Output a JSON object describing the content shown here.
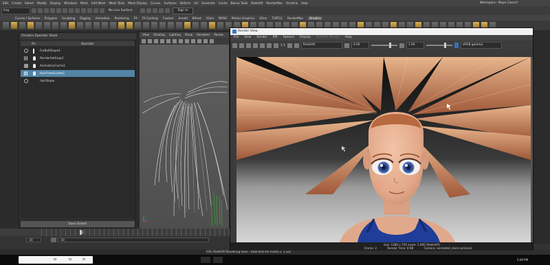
{
  "menubar": {
    "items": [
      "Edit",
      "Create",
      "Select",
      "Modify",
      "Display",
      "Windows",
      "Mesh",
      "Edit Mesh",
      "Mesh Tools",
      "Mesh Display",
      "Curves",
      "Surfaces",
      "Deform",
      "UV",
      "Generate",
      "Cache",
      "Bonus Tools",
      "Redshift",
      "RenderMan",
      "Ornatrix",
      "Help"
    ],
    "workspace": "Workspace : Maya Classic*"
  },
  "statusline": {
    "mode": "ling",
    "live_surface": "No Live Surface",
    "sign_in": "Sign In"
  },
  "shelf_tabs": [
    "Curves / Surfaces",
    "Polygons",
    "Sculpting",
    "Rigging",
    "Animation",
    "Rendering",
    "FX",
    "FX Caching",
    "Custom",
    "Arnold",
    "Bifrost",
    "XGen",
    "MASH",
    "Motion Graphics",
    "XGen",
    "TURTLE",
    "RenderMan",
    "Ornatrix"
  ],
  "shelf_active_tab": "Ornatrix",
  "operator_stack": {
    "title": "Ornatrix Operator Stack",
    "col_on": "On",
    "col_operator": "Operator",
    "rows": [
      {
        "label": "FurBallShape1",
        "selected": false
      },
      {
        "label": "RenderSettings1",
        "selected": false
      },
      {
        "label": "AnimationCache1",
        "selected": false
      },
      {
        "label": "HairFromGuides1",
        "selected": true
      },
      {
        "label": "hairShape",
        "selected": false
      }
    ],
    "save_groom": "Save Groom"
  },
  "viewport": {
    "menu": [
      "View",
      "Shading",
      "Lighting",
      "Show",
      "Renderer",
      "Panels"
    ]
  },
  "timeline": {
    "current_frame": "2",
    "range_start": "-30",
    "range_end": "-30"
  },
  "helpline": "Info: Redshift Rendering done - total time for frame 2: 1:12s",
  "render_view": {
    "title": "Render View",
    "menu": [
      "File",
      "View",
      "Render",
      "IPR",
      "Options",
      "Display",
      "Redshift Render",
      "Help"
    ],
    "renderer": "Redshift",
    "ratio": "1:1",
    "exposure": "0.00",
    "gamma": "1.00",
    "color_space": "sRGB gamma",
    "info_size": "size: 1280 x 720  zoom: 1.000   (Redshift)",
    "info_frame": "Frame: 2",
    "info_time": "Render Time: 0:08",
    "info_camera": "Camera: animated_stare:camera1"
  },
  "taskbar": {
    "clock": "5:09 PM"
  },
  "colors": {
    "selection": "#5285a6",
    "hair": "#c9875a",
    "skin": "#e8b394",
    "top": "#1f3e9a"
  }
}
